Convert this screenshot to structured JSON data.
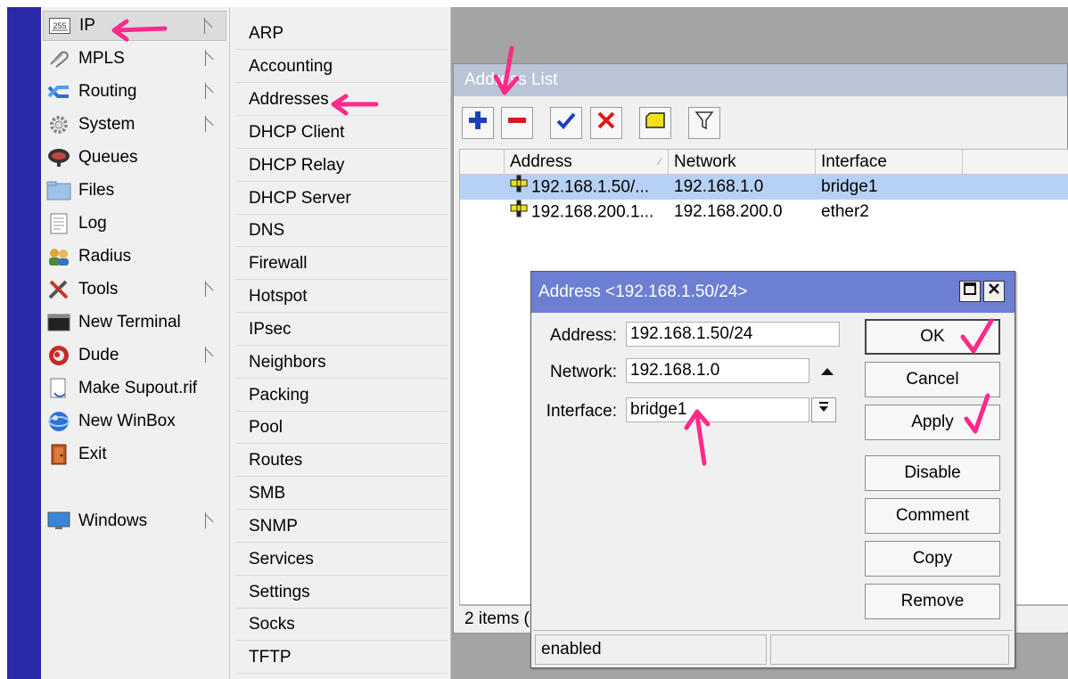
{
  "left_menu": {
    "items": [
      {
        "label": "IP",
        "icon": "ip-icon"
      },
      {
        "label": "MPLS",
        "icon": "mpls-icon"
      },
      {
        "label": "Routing",
        "icon": "routing-icon"
      },
      {
        "label": "System",
        "icon": "system-gear-icon"
      },
      {
        "label": "Queues",
        "icon": "queues-icon"
      },
      {
        "label": "Files",
        "icon": "folder-icon"
      },
      {
        "label": "Log",
        "icon": "log-icon"
      },
      {
        "label": "Radius",
        "icon": "radius-users-icon"
      },
      {
        "label": "Tools",
        "icon": "tools-icon"
      },
      {
        "label": "New Terminal",
        "icon": "terminal-icon"
      },
      {
        "label": "Dude",
        "icon": "dude-icon"
      },
      {
        "label": "Make Supout.rif",
        "icon": "supout-file-icon"
      },
      {
        "label": "New WinBox",
        "icon": "winbox-globe-icon"
      },
      {
        "label": "Exit",
        "icon": "exit-door-icon"
      },
      {
        "label": "Windows",
        "icon": "windows-monitor-icon"
      }
    ],
    "ip_icon_text": "255"
  },
  "submenu": {
    "items": [
      "ARP",
      "Accounting",
      "Addresses",
      "DHCP Client",
      "DHCP Relay",
      "DHCP Server",
      "DNS",
      "Firewall",
      "Hotspot",
      "IPsec",
      "Neighbors",
      "Packing",
      "Pool",
      "Routes",
      "SMB",
      "SNMP",
      "Services",
      "Settings",
      "Socks",
      "TFTP"
    ]
  },
  "address_list": {
    "title": "Address List",
    "columns": [
      "Address",
      "Network",
      "Interface"
    ],
    "rows": [
      {
        "address": "192.168.1.50/...",
        "network": "192.168.1.0",
        "interface": "bridge1",
        "selected": true
      },
      {
        "address": "192.168.200.1...",
        "network": "192.168.200.0",
        "interface": "ether2",
        "selected": false
      }
    ],
    "status": "2 items ("
  },
  "dialog": {
    "title": "Address <192.168.1.50/24>",
    "address_label": "Address:",
    "address_value": "192.168.1.50/24",
    "network_label": "Network:",
    "network_value": "192.168.1.0",
    "interface_label": "Interface:",
    "interface_value": "bridge1",
    "buttons": {
      "ok": "OK",
      "cancel": "Cancel",
      "apply": "Apply",
      "disable": "Disable",
      "comment": "Comment",
      "copy": "Copy",
      "remove": "Remove"
    },
    "status": "enabled"
  },
  "colors": {
    "annotation": "#ff2a8a",
    "sidebar_strip": "#2a2aa8",
    "dialog_title": "#6c7fd2",
    "selected_row": "#b7d1f5"
  }
}
